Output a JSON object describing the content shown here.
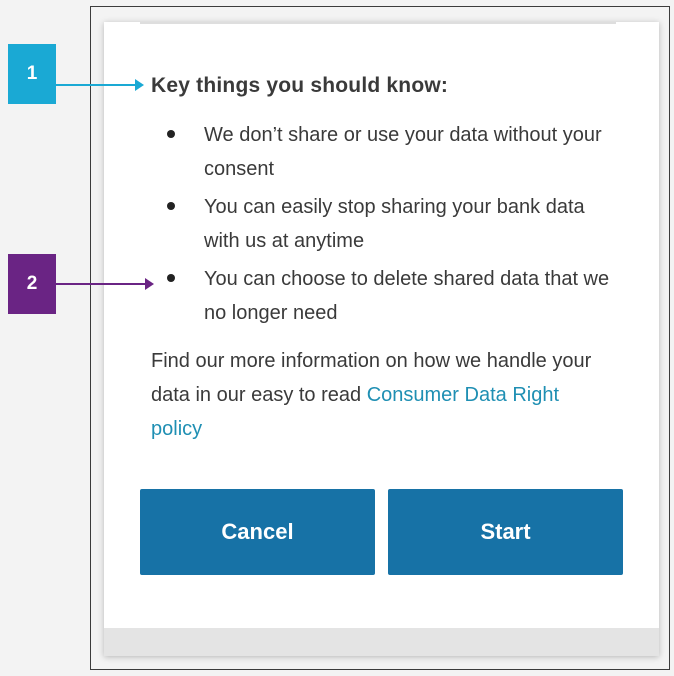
{
  "heading": "Key things you should know:",
  "bullets": [
    "We don’t share or use your data without your consent",
    "You can easily stop sharing your bank data with us at anytime",
    "You can choose to delete shared data that we no longer need"
  ],
  "info": {
    "text": "Find our more information on how we handle your data in our easy to read ",
    "link_label": "Consumer Data Right policy"
  },
  "buttons": {
    "cancel": "Cancel",
    "start": "Start"
  },
  "callouts": [
    {
      "number": "1",
      "color": "#1aa9d4"
    },
    {
      "number": "2",
      "color": "#6a2484"
    }
  ],
  "colors": {
    "button_bg": "#1772a6",
    "link": "#1f8fb3",
    "text": "#3a3a3a"
  }
}
